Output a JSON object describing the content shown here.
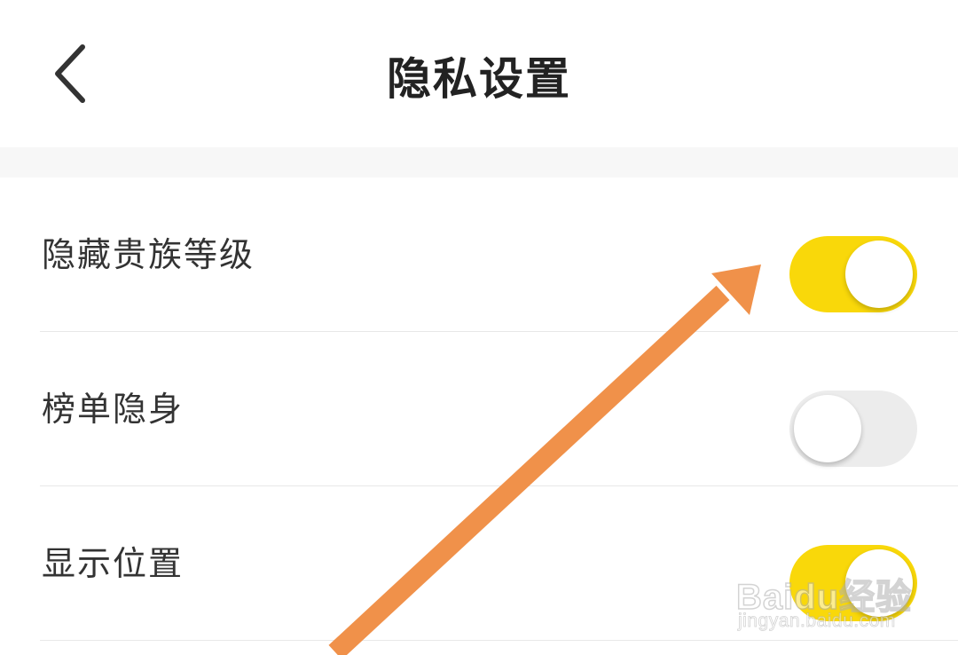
{
  "header": {
    "title": "隐私设置",
    "back_icon": "chevron-left-icon"
  },
  "settings": [
    {
      "label": "隐藏贵族等级",
      "enabled": true
    },
    {
      "label": "榜单隐身",
      "enabled": false
    },
    {
      "label": "显示位置",
      "enabled": true
    }
  ],
  "colors": {
    "toggle_on": "#f9d80a",
    "toggle_off": "#ececec",
    "annotation_arrow": "#f0914a"
  },
  "watermark": {
    "brand": "Baidu经验",
    "url": "jingyan.baidu.com"
  }
}
